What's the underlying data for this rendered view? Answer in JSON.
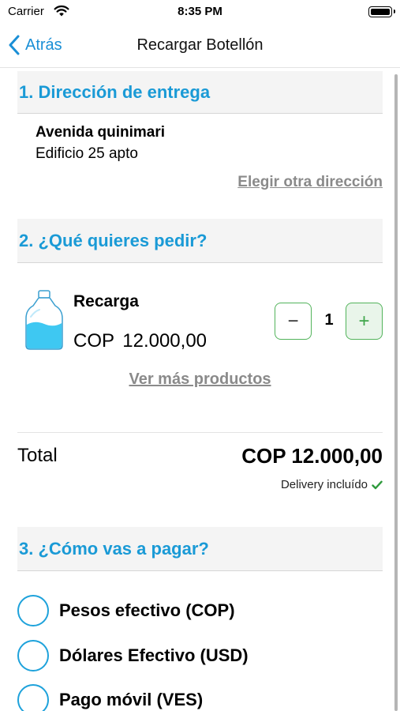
{
  "status_bar": {
    "carrier": "Carrier",
    "time": "8:35 PM"
  },
  "nav": {
    "back_label": "Atrás",
    "title": "Recargar Botellón"
  },
  "delivery": {
    "header": "1. Dirección de entrega",
    "address_line1": "Avenida quinimari",
    "address_line2": "Edificio 25 apto",
    "change_link": "Elegir otra dirección"
  },
  "order": {
    "header": "2. ¿Qué quieres pedir?",
    "product_name": "Recarga",
    "product_price": "COP 12.000,00",
    "quantity": "1",
    "minus_label": "−",
    "plus_label": "+",
    "more_link": "Ver más productos"
  },
  "total": {
    "label": "Total",
    "value": "COP 12.000,00",
    "delivery_note": "Delivery incluído"
  },
  "payment": {
    "header": "3. ¿Cómo vas a pagar?",
    "options": [
      "Pesos efectivo (COP)",
      "Dólares Efectivo (USD)",
      "Pago móvil (VES)"
    ]
  },
  "colors": {
    "accent": "#1a9ad6",
    "link_gray": "#8a8a8a",
    "qty_border": "#52b35b",
    "check_green": "#2e9a3c",
    "water_blue": "#3ec8f2"
  },
  "icons": {
    "wifi": "wifi-icon",
    "battery": "battery-icon",
    "back": "chevron-left-icon",
    "bottle": "water-bottle-icon",
    "check": "checkmark-icon"
  }
}
